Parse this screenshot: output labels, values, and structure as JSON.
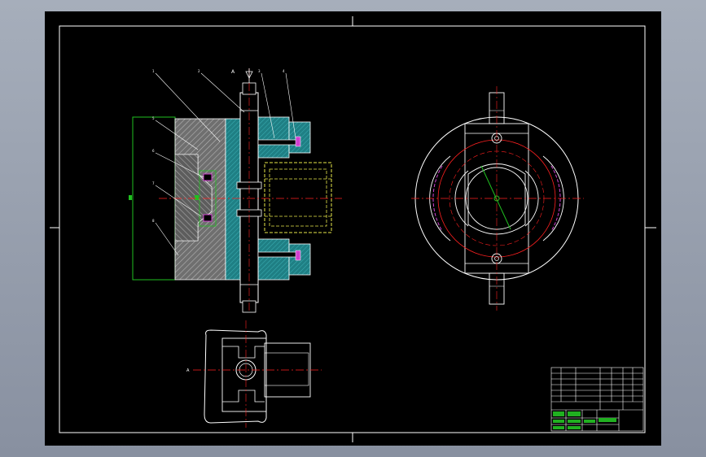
{
  "drawing": {
    "view_marker": "A",
    "section_marker": "A",
    "balloons": [
      "1",
      "2",
      "3",
      "4",
      "5",
      "6",
      "7",
      "8"
    ]
  },
  "title_block": {
    "rows": [
      "",
      "",
      "",
      "",
      "",
      "",
      "",
      ""
    ],
    "footer": [
      "",
      "",
      "",
      ""
    ]
  },
  "colors": {
    "sheet": "#000000",
    "outline": "#ffffff",
    "center_line": "#ff2020",
    "hatch": "#9a9a9a",
    "body_fill": "#2a8c8c",
    "hidden_line": "#e8e84a",
    "frame_line": "#20c020",
    "arc_accent": "#d040d0",
    "title_fill": "#20b020"
  }
}
